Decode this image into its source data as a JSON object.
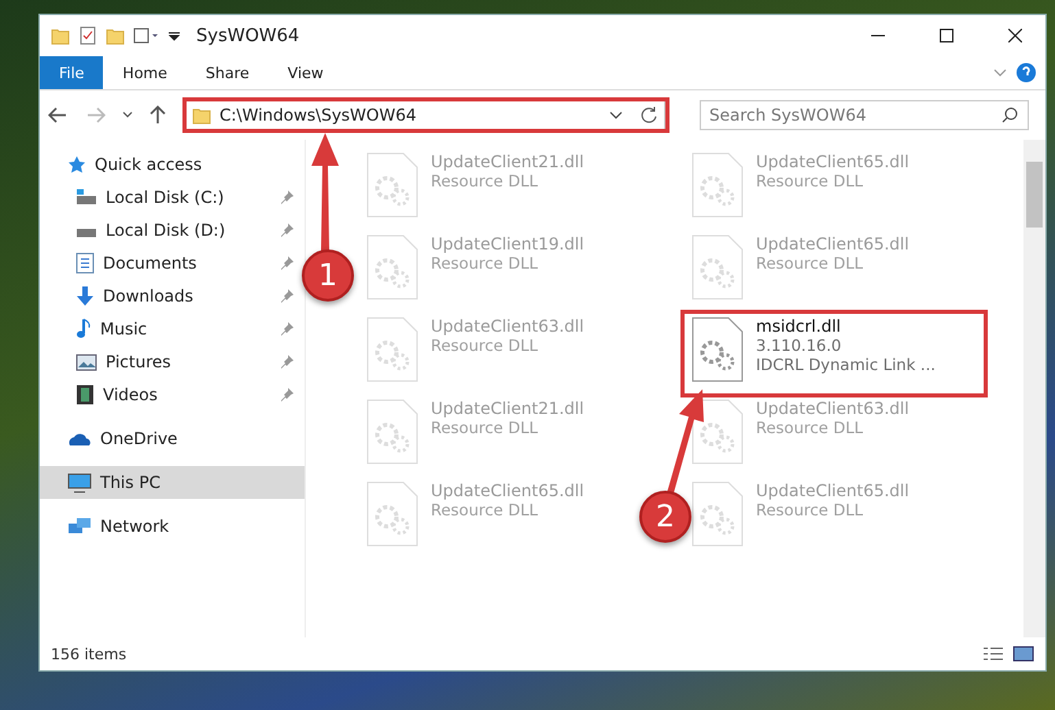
{
  "window": {
    "title": "SysWOW64"
  },
  "ribbon_tabs": [
    {
      "label": "File",
      "selected": true
    },
    {
      "label": "Home",
      "selected": false
    },
    {
      "label": "Share",
      "selected": false
    },
    {
      "label": "View",
      "selected": false
    }
  ],
  "address_bar": {
    "path": "C:\\Windows\\SysWOW64"
  },
  "search": {
    "placeholder": "Search SysWOW64"
  },
  "sidebar": {
    "items": [
      {
        "label": "Quick access",
        "kind": "star",
        "selected": false,
        "children": [
          {
            "label": "Local Disk (C:)",
            "kind": "disk-c",
            "selected": false,
            "pinned": true
          },
          {
            "label": "Local Disk (D:)",
            "kind": "disk",
            "selected": false,
            "pinned": true
          },
          {
            "label": "Documents",
            "kind": "documents",
            "selected": false,
            "pinned": true
          },
          {
            "label": "Downloads",
            "kind": "downloads",
            "selected": false,
            "pinned": true
          },
          {
            "label": "Music",
            "kind": "music",
            "selected": false,
            "pinned": true
          },
          {
            "label": "Pictures",
            "kind": "pictures",
            "selected": false,
            "pinned": true
          },
          {
            "label": "Videos",
            "kind": "videos",
            "selected": false,
            "pinned": true
          }
        ]
      },
      {
        "label": "OneDrive",
        "kind": "cloud",
        "selected": false
      },
      {
        "label": "This PC",
        "kind": "pc",
        "selected": true
      },
      {
        "label": "Network",
        "kind": "network",
        "selected": false
      }
    ]
  },
  "files": [
    {
      "name": "UpdateClient21.dll",
      "details": [
        "Resource DLL"
      ],
      "highlighted": false
    },
    {
      "name": "UpdateClient65.dll",
      "details": [
        "Resource DLL"
      ],
      "highlighted": false
    },
    {
      "name": "UpdateClient19.dll",
      "details": [
        "Resource DLL"
      ],
      "highlighted": false
    },
    {
      "name": "UpdateClient65.dll",
      "details": [
        "Resource DLL"
      ],
      "highlighted": false
    },
    {
      "name": "UpdateClient63.dll",
      "details": [
        "Resource DLL"
      ],
      "highlighted": false
    },
    {
      "name": "msidcrl.dll",
      "details": [
        "3.110.16.0",
        "IDCRL Dynamic Link ..."
      ],
      "highlighted": true
    },
    {
      "name": "UpdateClient21.dll",
      "details": [
        "Resource DLL"
      ],
      "highlighted": false
    },
    {
      "name": "UpdateClient63.dll",
      "details": [
        "Resource DLL"
      ],
      "highlighted": false
    },
    {
      "name": "UpdateClient65.dll",
      "details": [
        "Resource DLL"
      ],
      "highlighted": false
    },
    {
      "name": "UpdateClient65.dll",
      "details": [
        "Resource DLL"
      ],
      "highlighted": false
    }
  ],
  "status_bar": {
    "count": "156 items"
  },
  "annotations": [
    {
      "number": "1"
    },
    {
      "number": "2"
    }
  ]
}
